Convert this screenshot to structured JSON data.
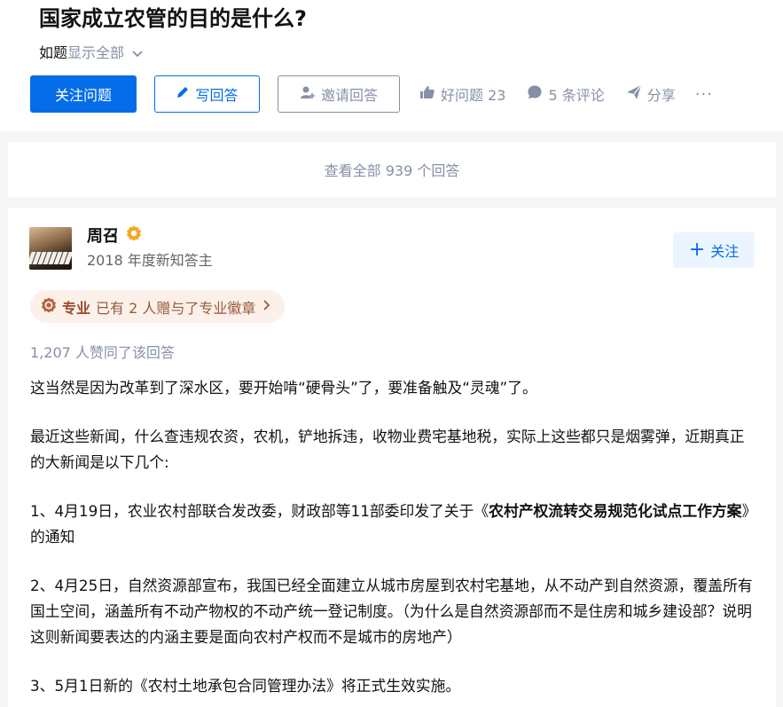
{
  "question": {
    "title": "国家成立农管的目的是什么?",
    "topic_text": "如题",
    "show_all": "显示全部"
  },
  "actions": {
    "follow_question": "关注问题",
    "write_answer": "写回答",
    "invite_answer": "邀请回答",
    "good_question": "好问题 23",
    "comments": "5 条评论",
    "share": "分享",
    "more": "···"
  },
  "view_all_answers": "查看全部 939 个回答",
  "answer": {
    "author_name": "周召",
    "author_headline": "2018 年度新知答主",
    "follow_label": "关注",
    "pro_label": "专业",
    "pro_text": "已有 2 人赠与了专业徽章",
    "votes_text": "1,207 人赞同了该回答",
    "paragraphs": [
      "这当然是因为改革到了深水区，要开始啃“硬骨头”了，要准备触及“灵魂”了。",
      "最近这些新闻，什么查违规农资，农机，铲地拆违，收物业费宅基地税，实际上这些都只是烟雾弹，近期真正的大新闻是以下几个:",
      "2、4月25日，自然资源部宣布，我国已经全面建立从城市房屋到农村宅基地，从不动产到自然资源，覆盖所有国土空间，涵盖所有不动产物权的不动产统一登记制度。（为什么是自然资源部而不是住房和城乡建设部？说明这则新闻要表达的内涵主要是面向农村产权而不是城市的房地产）",
      "3、5月1日新的《农村土地承包合同管理办法》将正式生效实施。"
    ],
    "p3_prefix": "1、4月19日，农业农村部联合发改委，财政部等11部委印发了关于《",
    "p3_bold": "农村产权流转交易规范化试点工作方案",
    "p3_suffix": "》的通知"
  },
  "colors": {
    "primary_blue": "#056de8",
    "meta_gray": "#8590a6",
    "badge_orange": "#f5a623",
    "pro_chip_bg": "#fcf1ea"
  },
  "icons": [
    "chevron-down-icon",
    "pencil-icon",
    "invite-user-icon",
    "thumbs-up-icon",
    "comment-icon",
    "share-icon",
    "verified-badge-icon",
    "pro-badge-icon",
    "chevron-right-icon",
    "plus-icon"
  ]
}
